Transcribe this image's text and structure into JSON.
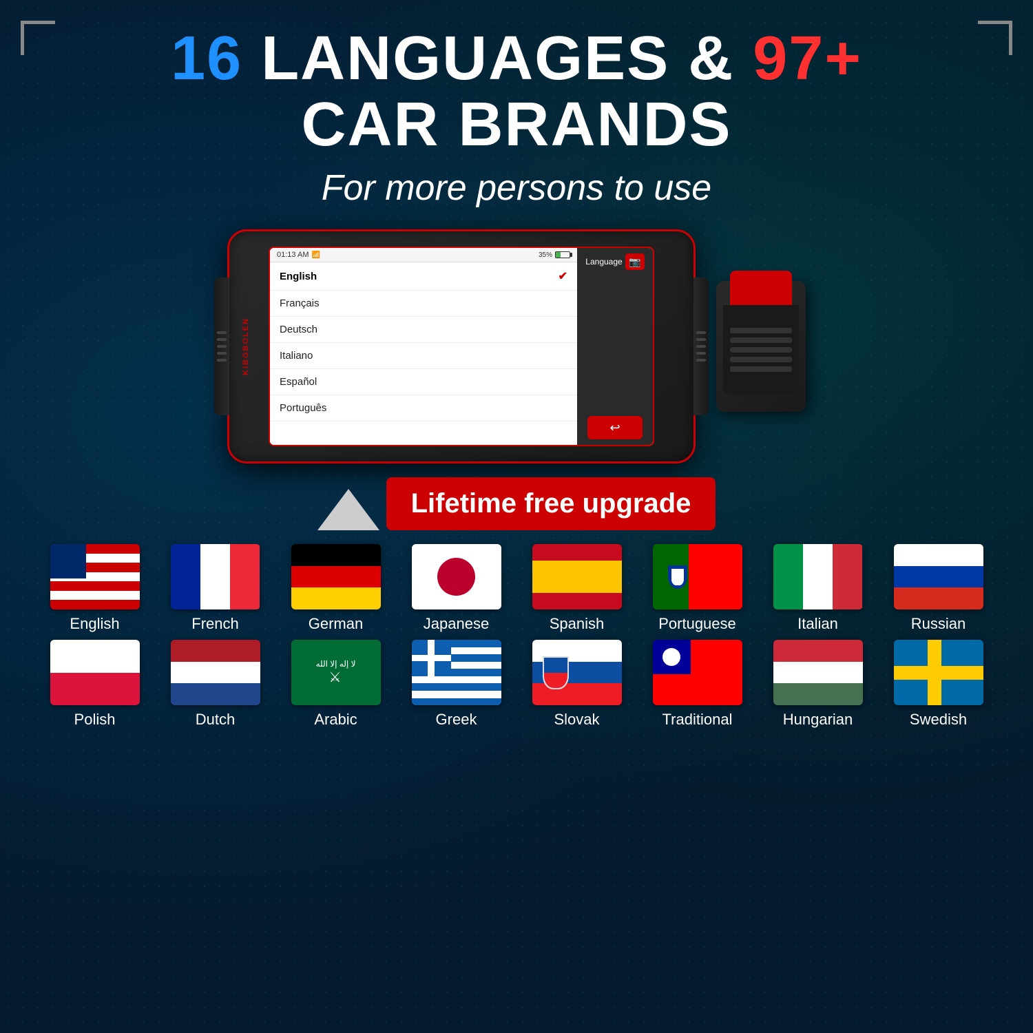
{
  "header": {
    "line1_number": "16",
    "line1_text": " LANGUAGES &",
    "line1_number2": "97+",
    "line2_text": "CAR BRANDS",
    "subtitle": "For more persons to use"
  },
  "device": {
    "brand": "KIBGBOLEN",
    "screen": {
      "time": "01:13 AM",
      "battery": "35%",
      "selected_language": "English",
      "languages": [
        "English",
        "Français",
        "Deutsch",
        "Italiano",
        "Español",
        "Português"
      ],
      "panel_title": "Language"
    }
  },
  "upgrade_badge": "Lifetime free upgrade",
  "languages_row1": [
    {
      "label": "English",
      "code": "us"
    },
    {
      "label": "French",
      "code": "fr"
    },
    {
      "label": "German",
      "code": "de"
    },
    {
      "label": "Japanese",
      "code": "jp"
    },
    {
      "label": "Spanish",
      "code": "es"
    },
    {
      "label": "Portuguese",
      "code": "pt"
    },
    {
      "label": "Italian",
      "code": "it"
    },
    {
      "label": "Russian",
      "code": "ru"
    }
  ],
  "languages_row2": [
    {
      "label": "Polish",
      "code": "pl"
    },
    {
      "label": "Dutch",
      "code": "nl"
    },
    {
      "label": "Arabic",
      "code": "ar"
    },
    {
      "label": "Greek",
      "code": "gr"
    },
    {
      "label": "Slovak",
      "code": "sk"
    },
    {
      "label": "Traditional",
      "code": "tw"
    },
    {
      "label": "Hungarian",
      "code": "hu"
    },
    {
      "label": "Swedish",
      "code": "se"
    }
  ]
}
